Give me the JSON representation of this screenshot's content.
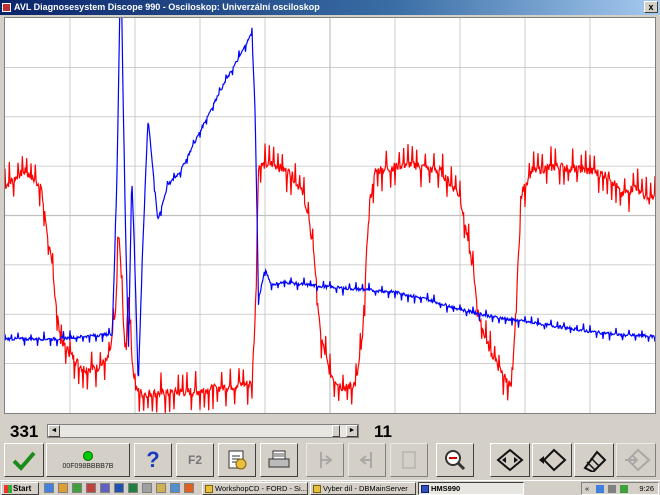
{
  "window": {
    "title": "AVL Diagnosesystem Discope 990 - Osciloskop: Univerzální osciloskop",
    "close_glyph": "x"
  },
  "status": {
    "left_value": "331",
    "right_value": "11"
  },
  "toolbar": {
    "status_text": "00F098BBBB7B",
    "help_glyph": "?",
    "f2_label": "F2"
  },
  "taskbar": {
    "start_label": "Start",
    "tasks": [
      {
        "label": "WorkshopCD - FORD - Si..."
      },
      {
        "label": "Vyber díl - DBMainServer"
      },
      {
        "label": "HMS990"
      }
    ],
    "clock": "9:26",
    "tray_arrow": "«"
  },
  "colors": {
    "channel_a": "#ff0000",
    "channel_b": "#0000ff",
    "grid": "#c0c0c0"
  },
  "chart_data": {
    "type": "line",
    "title": "",
    "xlabel": "",
    "ylabel": "",
    "grid": true,
    "xlim": [
      0,
      10
    ],
    "ylim": [
      0,
      8
    ],
    "series": [
      {
        "color": "#ff0000",
        "x": [
          0,
          0.3,
          0.55,
          0.7,
          0.85,
          1.0,
          1.2,
          1.4,
          1.6,
          1.7,
          1.75,
          1.85,
          1.9,
          1.95,
          2.0,
          2.1,
          2.5,
          3.0,
          3.5,
          3.8,
          3.85,
          3.9,
          4.1,
          4.4,
          4.6,
          4.75,
          4.85,
          5.0,
          5.2,
          5.4,
          5.5,
          5.6,
          5.7,
          6.2,
          6.7,
          7.0,
          7.2,
          7.3,
          7.45,
          7.6,
          7.8,
          7.9,
          7.95,
          8.1,
          8.5,
          9.0,
          9.3,
          9.5,
          9.7,
          9.9,
          10
        ],
        "values": [
          4.6,
          4.9,
          4.6,
          3.2,
          1.5,
          1.2,
          0.9,
          0.9,
          1.1,
          2.0,
          3.7,
          1.2,
          2.4,
          1.2,
          0.5,
          0.4,
          0.4,
          0.45,
          0.55,
          0.6,
          2.0,
          5.0,
          5.05,
          4.85,
          4.4,
          3.3,
          1.6,
          0.8,
          0.5,
          0.6,
          1.5,
          4.2,
          4.9,
          5.05,
          4.9,
          4.4,
          2.9,
          1.9,
          1.3,
          0.9,
          0.5,
          3.2,
          4.45,
          4.9,
          5.0,
          4.9,
          4.8,
          4.4,
          4.6,
          4.3,
          4.4
        ]
      },
      {
        "color": "#0000ff",
        "x": [
          0,
          0.8,
          1.2,
          1.65,
          1.72,
          1.78,
          1.85,
          1.9,
          1.95,
          2.0,
          2.05,
          2.1,
          2.2,
          2.35,
          2.5,
          2.7,
          3.0,
          3.3,
          3.6,
          3.8,
          3.85,
          3.9,
          4.0,
          4.1,
          4.3,
          4.6,
          5.0,
          5.5,
          6.0,
          6.5,
          7.0,
          7.5,
          8.0,
          8.5,
          9.0,
          9.5,
          10
        ],
        "values": [
          1.5,
          1.5,
          1.55,
          1.6,
          4.6,
          9.2,
          4.0,
          1.2,
          4.8,
          3.0,
          0.5,
          2.7,
          6.0,
          3.9,
          4.6,
          4.9,
          5.7,
          6.5,
          7.2,
          7.7,
          6.0,
          2.3,
          2.9,
          2.6,
          2.65,
          2.6,
          2.55,
          2.5,
          2.45,
          2.3,
          2.1,
          1.95,
          1.85,
          1.75,
          1.65,
          1.58,
          1.55
        ]
      }
    ]
  }
}
